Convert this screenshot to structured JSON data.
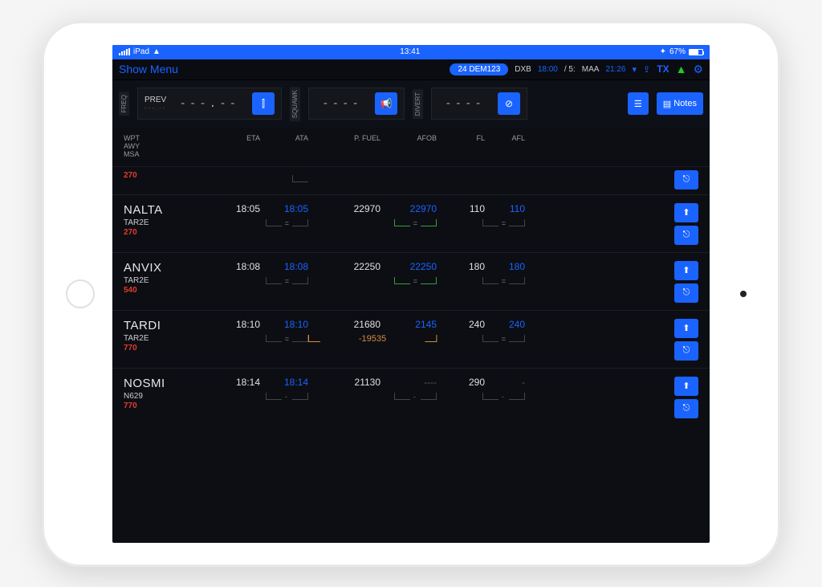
{
  "status": {
    "carrier": "iPad",
    "time": "13:41",
    "battery": "67%"
  },
  "header": {
    "menu": "Show Menu",
    "flight": "24 DEM123",
    "dep_code": "DXB",
    "dep_time": "18:00",
    "dep_sep": "/ 5:",
    "sep2": "/",
    "arr_code": "MAA",
    "arr_time": "21:26",
    "tx": "TX"
  },
  "ctrl": {
    "freq_tab": "FREQ",
    "prev": "PREV",
    "prev_sub": "---.--",
    "freq_val": "---.--",
    "squawk_tab": "SQUAWK",
    "squawk_val": "----",
    "divert_tab": "DIVERT",
    "divert_val": "----",
    "notes": "Notes"
  },
  "thead": {
    "wpt": "WPT",
    "awy": "AWY",
    "msa": "MSA",
    "eta": "ETA",
    "ata": "ATA",
    "pfuel": "P. FUEL",
    "afob": "AFOB",
    "fl": "FL",
    "afl": "AFL"
  },
  "rows": [
    {
      "partial": true,
      "msa": "270"
    },
    {
      "name": "NALTA",
      "awy": "TAR2E",
      "msa": "270",
      "eta": "18:05",
      "ata": "18:05",
      "pfuel": "22970",
      "afob": "22970",
      "fl": "110",
      "afl": "110",
      "eq": true
    },
    {
      "name": "ANVIX",
      "awy": "TAR2E",
      "msa": "540",
      "eta": "18:08",
      "ata": "18:08",
      "pfuel": "22250",
      "afob": "22250",
      "fl": "180",
      "afl": "180",
      "eq": true
    },
    {
      "name": "TARDI",
      "awy": "TAR2E",
      "msa": "770",
      "eta": "18:10",
      "ata": "18:10",
      "pfuel": "21680",
      "afob": "2145",
      "fl": "240",
      "afl": "240",
      "fuel_diff": "-19535",
      "eq": true
    },
    {
      "name": "NOSMI",
      "awy": "N629",
      "msa": "770",
      "eta": "18:14",
      "ata": "18:14",
      "pfuel": "21130",
      "afob": "----",
      "fl": "290",
      "afl": "-",
      "dash": true
    }
  ]
}
